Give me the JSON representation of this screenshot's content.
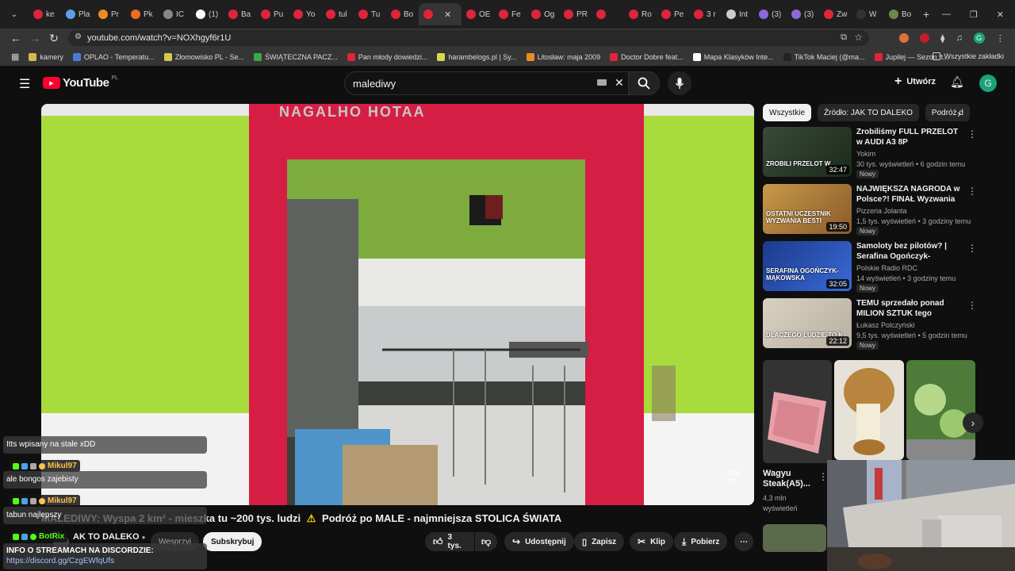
{
  "browser": {
    "tabs": [
      {
        "label": "ke",
        "color": "#e0243a"
      },
      {
        "label": "Pla",
        "color": "#5aa0e8"
      },
      {
        "label": "Pr",
        "color": "#f08a24"
      },
      {
        "label": "Pk",
        "color": "#f06a24"
      },
      {
        "label": "IC",
        "color": "#888888"
      },
      {
        "label": "(1)",
        "color": "#ffffff"
      },
      {
        "label": "Ba",
        "color": "#e0243a"
      },
      {
        "label": "Pu",
        "color": "#e0243a"
      },
      {
        "label": "Yo",
        "color": "#e0243a"
      },
      {
        "label": "tul",
        "color": "#e0243a"
      },
      {
        "label": "Tu",
        "color": "#e0243a"
      },
      {
        "label": "Bo",
        "color": "#e0243a"
      },
      {
        "label": "",
        "color": "#e0243a",
        "active": true
      },
      {
        "label": "OE",
        "color": "#e0243a"
      },
      {
        "label": "Fe",
        "color": "#e0243a"
      },
      {
        "label": "Og",
        "color": "#e0243a"
      },
      {
        "label": "PR",
        "color": "#e0243a"
      },
      {
        "label": "",
        "color": "#e0243a"
      },
      {
        "label": "Ro",
        "color": "#e0243a"
      },
      {
        "label": "Pe",
        "color": "#e0243a"
      },
      {
        "label": "3 r",
        "color": "#e0243a"
      },
      {
        "label": "Int",
        "color": "#cccccc"
      },
      {
        "label": "(3)",
        "color": "#8a6ad8"
      },
      {
        "label": "(3)",
        "color": "#8a6ad8"
      },
      {
        "label": "Zw",
        "color": "#e0243a"
      },
      {
        "label": "W",
        "color": "#333333"
      },
      {
        "label": "Bo",
        "color": "#6a8a4a"
      }
    ],
    "url": "youtube.com/watch?v=NOXhgyf6r1U",
    "bookmarks": [
      {
        "label": "kamery",
        "color": "#d9b84a"
      },
      {
        "label": "OPLAO - Temperatu...",
        "color": "#4a7ad8"
      },
      {
        "label": "Złomowisko PL - Se...",
        "color": "#d8c84a"
      },
      {
        "label": "ŚWIĄTECZNA PACZ...",
        "color": "#3aa84a"
      },
      {
        "label": "Pan młody dowiedzi...",
        "color": "#e0243a"
      },
      {
        "label": "harambelogs.pl | Sy...",
        "color": "#d8d84a"
      },
      {
        "label": "Litosław: maja 2009",
        "color": "#f08a24"
      },
      {
        "label": "Doctor Dobre feat...",
        "color": "#e0243a"
      },
      {
        "label": "Mapa Klasyków Inte...",
        "color": "#ffffff"
      },
      {
        "label": "TikTok Maciej (@ma...",
        "color": "#222222"
      },
      {
        "label": "Jupilej — Sezon ft...",
        "color": "#e0243a"
      }
    ],
    "all_bookmarks": "Wszystkie zakładki",
    "profile_initial": "G"
  },
  "youtube": {
    "logo": "YouTube",
    "region": "PL",
    "search_value": "malediwy",
    "create_label": "Utwórz",
    "avatar_initial": "G"
  },
  "video": {
    "sign_text": "NAGALHO HOTAA",
    "watermark": "JAK TO",
    "title_start": "MALEDIWY: Wyspa 2 km² - mieszka tu ~200 tys. ludzi",
    "title_warning": "⚠",
    "title_end": "Podróż po MALE - najmniejsza STOLICA ŚWIATA",
    "channel": "AK TO DALEKO",
    "support_label": "Wesprzyj",
    "subscribe_label": "Subskrybuj",
    "likes": "3 tys.",
    "share_label": "Udostępnij",
    "save_label": "Zapisz",
    "clip_label": "Klip",
    "download_label": "Pobierz"
  },
  "chips": [
    "Wszystkie",
    "Źródło: JAK TO DALEKO",
    "Podróż d"
  ],
  "recommendations": [
    {
      "title": "Zrobiliśmy FULL PRZELOT w AUDI A3 8P",
      "channel": "Yokim",
      "stats": "30 tys. wyświetleń • 6 godzin temu",
      "badge": "Nowy",
      "duration": "32:47",
      "thumb_text": "ZROBILI PRZELOT W"
    },
    {
      "title": "NAJWIĘKSZA NAGRODA w Polsce?! FINAŁ Wyzwania Bes...",
      "channel": "Pizzeria Jolanta",
      "stats": "1,5 tys. wyświetleń • 3 godziny temu",
      "badge": "Nowy",
      "duration": "19:50",
      "thumb_text": "OSTATNI UCZESTNIK WYZWANIA BESTI"
    },
    {
      "title": "Samoloty bez pilotów? | Serafina Ogończyk-Mąkowska...",
      "channel": "Polskie Radio RDC",
      "stats": "14 wyświetleń • 3 godziny temu",
      "badge": "Nowy",
      "duration": "32:05",
      "thumb_text": "SERAFINA OGOŃCZYK-MĄKOWSKA"
    },
    {
      "title": "TEMU sprzedało ponad MILION SZTUK tego produktu - co to ...",
      "channel": "Łukasz Polczyński",
      "stats": "9,5 tys. wyświetleń • 5 godzin temu",
      "badge": "Nowy",
      "duration": "22:12",
      "thumb_text": "DLACZEGO LUDZIE TO K"
    }
  ],
  "shorts": {
    "title": "Wagyu Steak(A5)...",
    "views": "4,3 mln",
    "views_label": "wyświetleń"
  },
  "chat": [
    {
      "type": "msg",
      "text": "Itts wpisany na stałe xDD"
    },
    {
      "type": "user",
      "name": "Mikul97"
    },
    {
      "type": "msg",
      "text": "ale bongos zajebisty"
    },
    {
      "type": "user",
      "name": "Mikul97"
    },
    {
      "type": "msg",
      "text": "tabun najlepszy"
    },
    {
      "type": "bot",
      "name": "BotRix"
    },
    {
      "type": "info",
      "text": "INFO O STREAMACH NA DISCORDZIE:"
    },
    {
      "type": "link",
      "text": "https://discord.gg/CzgEWfqUfs"
    }
  ]
}
